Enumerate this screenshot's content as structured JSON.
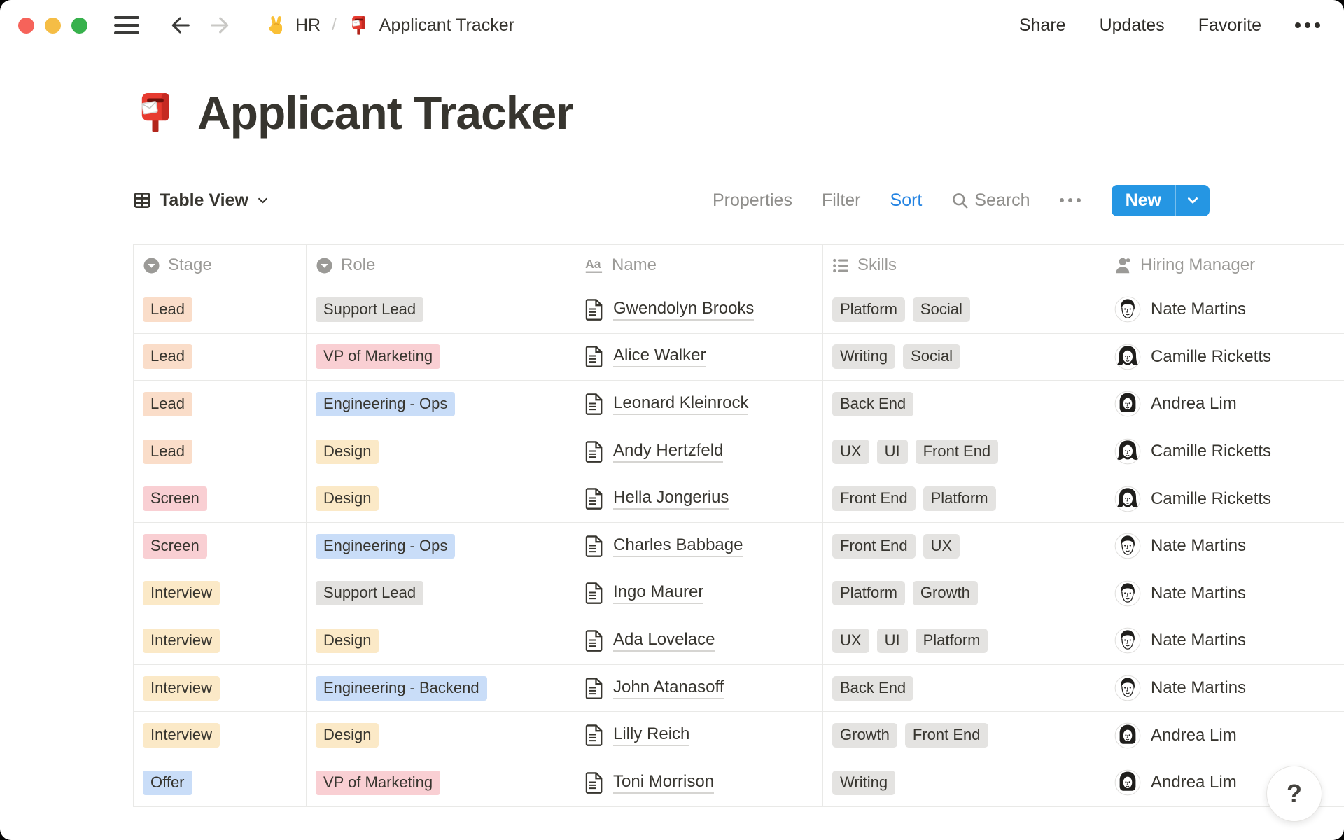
{
  "window": {
    "breadcrumb": {
      "workspace": "HR",
      "separator": "/",
      "page": "Applicant Tracker"
    },
    "actions": [
      "Share",
      "Updates",
      "Favorite"
    ]
  },
  "page": {
    "title": "Applicant Tracker"
  },
  "toolbar": {
    "view_label": "Table View",
    "properties": "Properties",
    "filter": "Filter",
    "sort": "Sort",
    "search": "Search",
    "new_label": "New"
  },
  "help_label": "?",
  "colors": {
    "accent_blue": "#2596E3",
    "sort_blue": "#2383E2",
    "tag_gray": "#E3E2E0",
    "tag_peach": "#FADDC9",
    "tag_pink": "#F9CFD3",
    "tag_yellow": "#FBE9C7",
    "tag_blue": "#C9DDF8",
    "skill_gray": "#E4E3E1"
  },
  "table": {
    "columns": [
      {
        "label": "Stage",
        "icon": "select-icon"
      },
      {
        "label": "Role",
        "icon": "select-icon"
      },
      {
        "label": "Name",
        "icon": "text-icon"
      },
      {
        "label": "Skills",
        "icon": "multiselect-icon"
      },
      {
        "label": "Hiring Manager",
        "icon": "person-icon"
      }
    ],
    "rows": [
      {
        "stage": "Lead",
        "stage_color": "tag_peach",
        "role": "Support Lead",
        "role_color": "tag_gray",
        "name": "Gwendolyn Brooks",
        "skills": [
          "Platform",
          "Social"
        ],
        "manager": "Nate Martins",
        "avatar": "avatar-nate-martins"
      },
      {
        "stage": "Lead",
        "stage_color": "tag_peach",
        "role": "VP of Marketing",
        "role_color": "tag_pink",
        "name": "Alice Walker",
        "skills": [
          "Writing",
          "Social"
        ],
        "manager": "Camille Ricketts",
        "avatar": "avatar-camille-ricketts"
      },
      {
        "stage": "Lead",
        "stage_color": "tag_peach",
        "role": "Engineering - Ops",
        "role_color": "tag_blue",
        "name": "Leonard Kleinrock",
        "skills": [
          "Back End"
        ],
        "manager": "Andrea Lim",
        "avatar": "avatar-andrea-lim"
      },
      {
        "stage": "Lead",
        "stage_color": "tag_peach",
        "role": "Design",
        "role_color": "tag_yellow",
        "name": "Andy Hertzfeld",
        "skills": [
          "UX",
          "UI",
          "Front End"
        ],
        "manager": "Camille Ricketts",
        "avatar": "avatar-camille-ricketts"
      },
      {
        "stage": "Screen",
        "stage_color": "tag_pink",
        "role": "Design",
        "role_color": "tag_yellow",
        "name": "Hella Jongerius",
        "skills": [
          "Front End",
          "Platform"
        ],
        "manager": "Camille Ricketts",
        "avatar": "avatar-camille-ricketts"
      },
      {
        "stage": "Screen",
        "stage_color": "tag_pink",
        "role": "Engineering - Ops",
        "role_color": "tag_blue",
        "name": "Charles Babbage",
        "skills": [
          "Front End",
          "UX"
        ],
        "manager": "Nate Martins",
        "avatar": "avatar-nate-martins"
      },
      {
        "stage": "Interview",
        "stage_color": "tag_yellow",
        "role": "Support Lead",
        "role_color": "tag_gray",
        "name": "Ingo Maurer",
        "skills": [
          "Platform",
          "Growth"
        ],
        "manager": "Nate Martins",
        "avatar": "avatar-nate-martins"
      },
      {
        "stage": "Interview",
        "stage_color": "tag_yellow",
        "role": "Design",
        "role_color": "tag_yellow",
        "name": "Ada Lovelace",
        "skills": [
          "UX",
          "UI",
          "Platform"
        ],
        "manager": "Nate Martins",
        "avatar": "avatar-nate-martins"
      },
      {
        "stage": "Interview",
        "stage_color": "tag_yellow",
        "role": "Engineering - Backend",
        "role_color": "tag_blue",
        "name": "John Atanasoff",
        "skills": [
          "Back End"
        ],
        "manager": "Nate Martins",
        "avatar": "avatar-nate-martins"
      },
      {
        "stage": "Interview",
        "stage_color": "tag_yellow",
        "role": "Design",
        "role_color": "tag_yellow",
        "name": "Lilly Reich",
        "skills": [
          "Growth",
          "Front End"
        ],
        "manager": "Andrea Lim",
        "avatar": "avatar-andrea-lim"
      },
      {
        "stage": "Offer",
        "stage_color": "tag_blue",
        "role": "VP of Marketing",
        "role_color": "tag_pink",
        "name": "Toni Morrison",
        "skills": [
          "Writing"
        ],
        "manager": "Andrea Lim",
        "avatar": "avatar-andrea-lim"
      }
    ]
  }
}
